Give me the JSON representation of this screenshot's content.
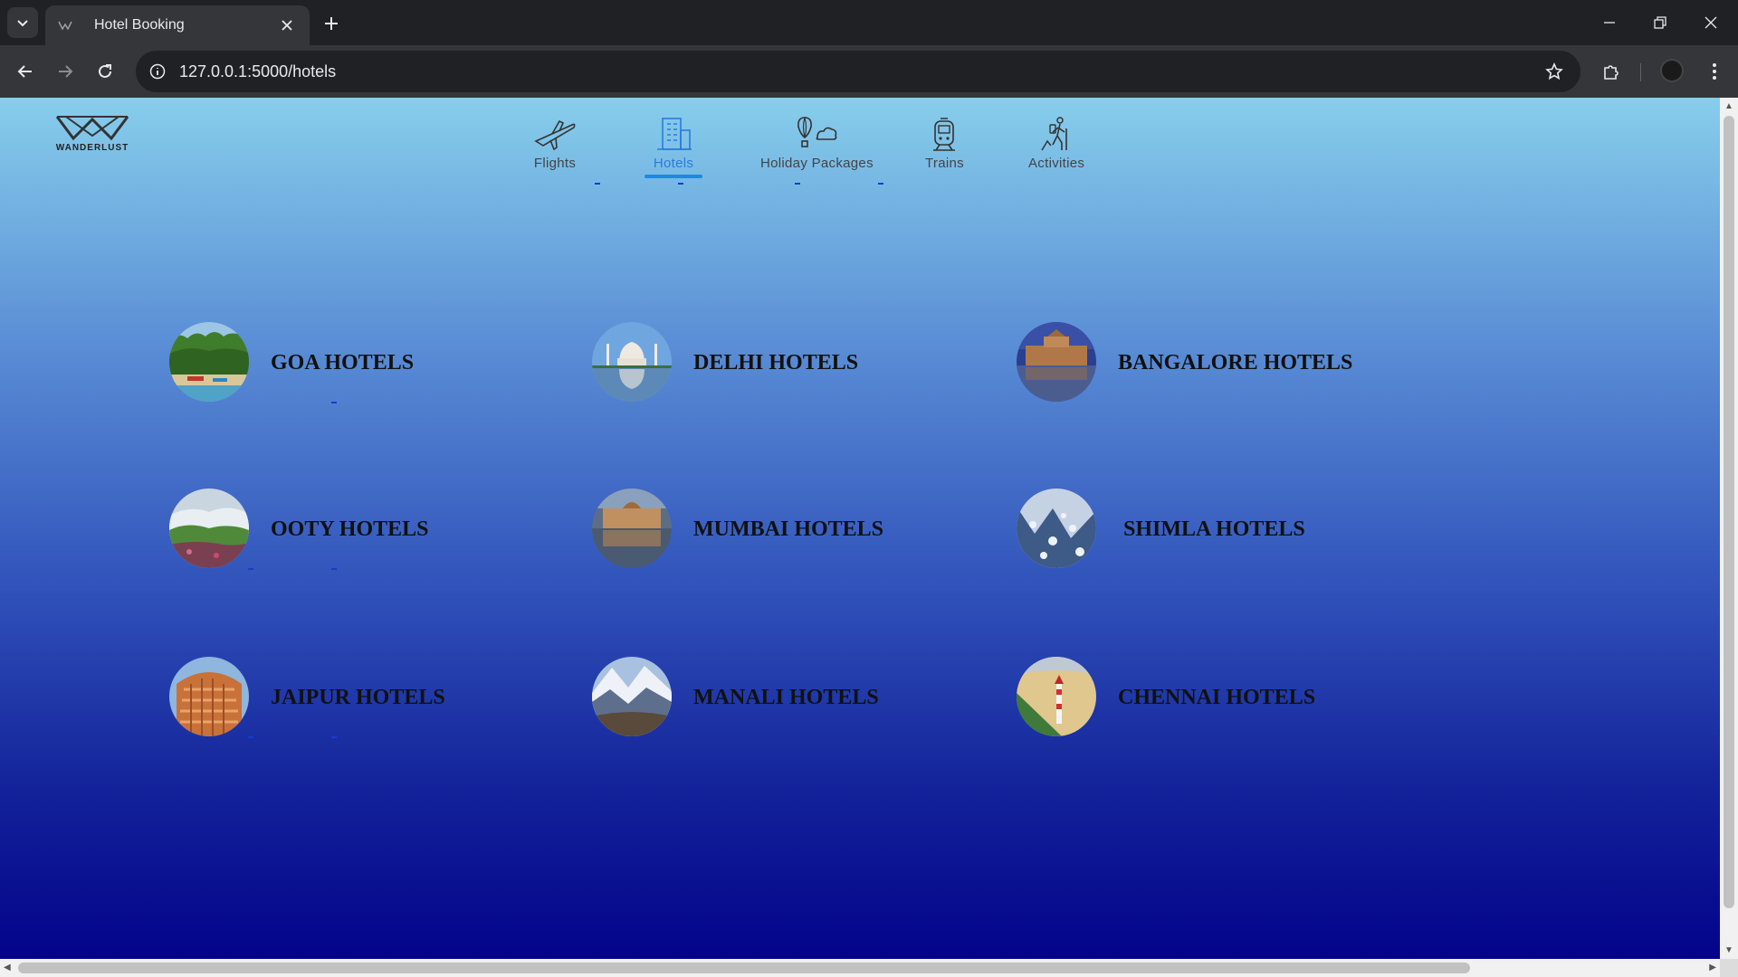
{
  "browser": {
    "tab_title": "Hotel Booking",
    "url": "127.0.0.1:5000/hotels"
  },
  "site": {
    "logo_text": "WANDERLUST",
    "nav": [
      {
        "label": "Flights",
        "icon": "plane-icon",
        "active": false
      },
      {
        "label": "Hotels",
        "icon": "building-icon",
        "active": true
      },
      {
        "label": "Holiday Packages",
        "icon": "balloon-icon",
        "active": false
      },
      {
        "label": "Trains",
        "icon": "train-icon",
        "active": false
      },
      {
        "label": "Activities",
        "icon": "hiker-icon",
        "active": false
      }
    ]
  },
  "cities": [
    {
      "name": "GOA HOTELS",
      "image": "beach palms"
    },
    {
      "name": "DELHI HOTELS",
      "image": "taj mahal"
    },
    {
      "name": "BANGALORE HOTELS",
      "image": "palace at dusk"
    },
    {
      "name": "OOTY HOTELS",
      "image": "misty hills"
    },
    {
      "name": "MUMBAI HOTELS",
      "image": "taj hotel reflection"
    },
    {
      "name": "SHIMLA HOTELS",
      "image": "snowy town"
    },
    {
      "name": "JAIPUR HOTELS",
      "image": "hawa mahal"
    },
    {
      "name": "MANALI HOTELS",
      "image": "snowy valley"
    },
    {
      "name": "CHENNAI HOTELS",
      "image": "lighthouse beach"
    }
  ],
  "colors": {
    "active_nav": "#1e88e5",
    "page_top": "#87ceeb",
    "page_bottom": "#03038a"
  }
}
